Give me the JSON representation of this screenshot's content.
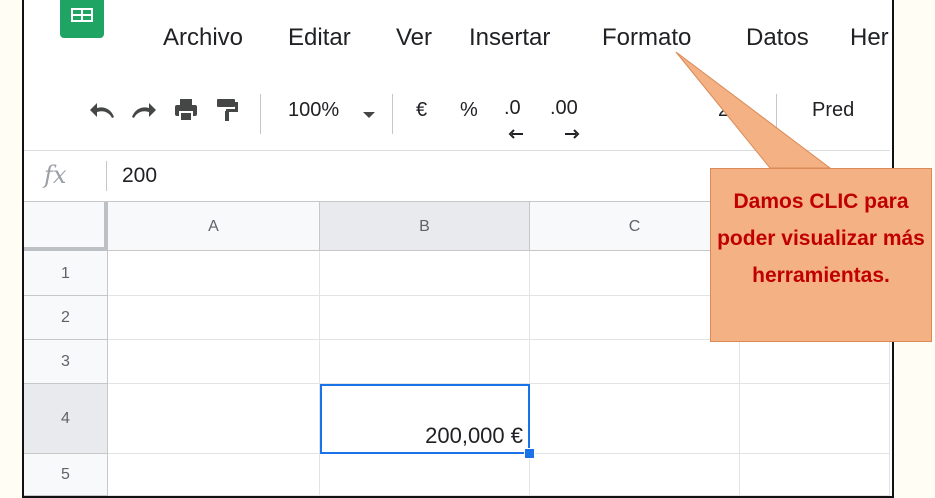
{
  "menu": {
    "items": [
      "Archivo",
      "Editar",
      "Ver",
      "Insertar",
      "Formato",
      "Datos",
      "Her"
    ]
  },
  "toolbar": {
    "zoom": "100%",
    "currency": "€",
    "percent": "%",
    "decrease_decimals": ".0",
    "increase_decimals": ".00",
    "more_formats": "23",
    "font": "Pred"
  },
  "formula_bar": {
    "label": "fx",
    "value": "200"
  },
  "sheet": {
    "columns": [
      "A",
      "B",
      "C"
    ],
    "rows": [
      "1",
      "2",
      "3",
      "4",
      "5"
    ],
    "selected_cell_value": "200,000 €"
  },
  "callout": {
    "text": "Damos CLIC para poder visualizar más herramientas."
  },
  "colors": {
    "sheets_green": "#1fa463",
    "selection_blue": "#1a73e8",
    "callout_fill": "#f4b183",
    "callout_text": "#c00000"
  },
  "icons": [
    "undo-icon",
    "redo-icon",
    "print-icon",
    "paint-format-icon",
    "dropdown-arrow-icon",
    "sheets-logo-icon"
  ]
}
